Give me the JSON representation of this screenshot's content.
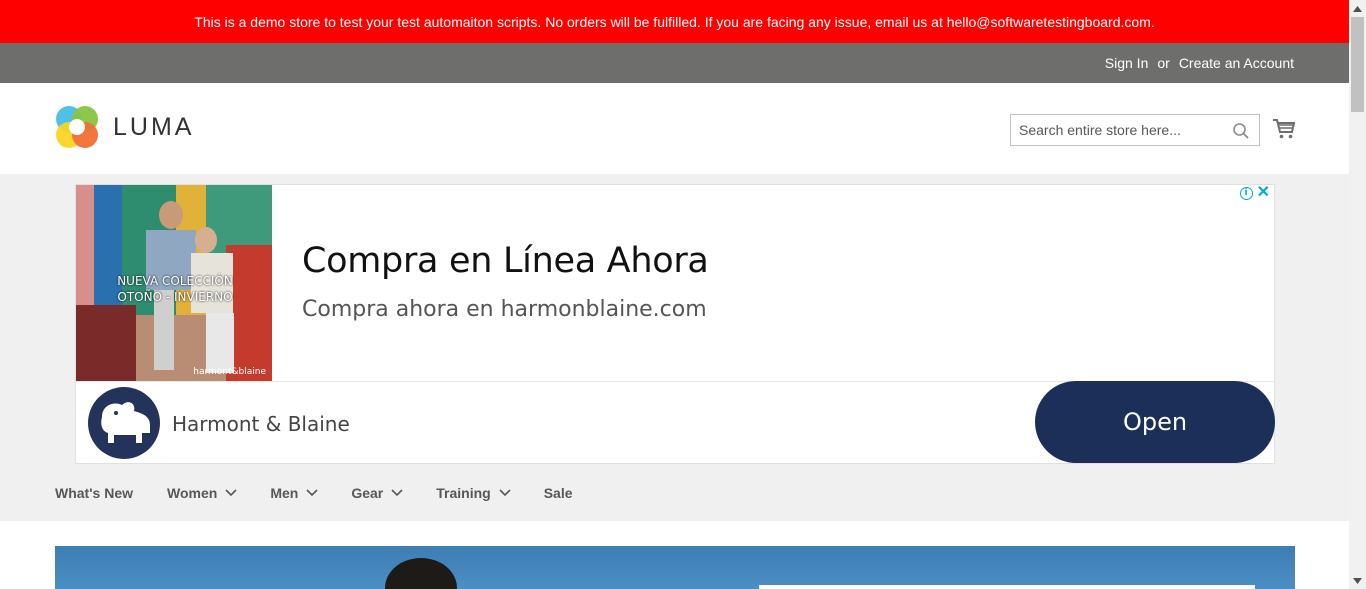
{
  "demo_notice": "This is a demo store to test your test automaiton scripts. No orders will be fulfilled. If you are facing any issue, email us at hello@softwaretestingboard.com.",
  "top_links": {
    "sign_in": "Sign In",
    "or": "or",
    "create_account": "Create an Account"
  },
  "logo": {
    "text": "LUMA"
  },
  "search": {
    "placeholder": "Search entire store here..."
  },
  "ad": {
    "image_text": "NUEVA COLECCIÓN OTOÑO - INVIERNO",
    "image_brand": "harmont&blaine",
    "title": "Compra en Línea Ahora",
    "subtitle": "Compra ahora en harmonblaine.com",
    "brand": "Harmont & Blaine",
    "cta": "Open",
    "info_icon": "i",
    "close_icon": "✕"
  },
  "nav": {
    "items": [
      {
        "label": "What's New",
        "has_dropdown": false
      },
      {
        "label": "Women",
        "has_dropdown": true
      },
      {
        "label": "Men",
        "has_dropdown": true
      },
      {
        "label": "Gear",
        "has_dropdown": true
      },
      {
        "label": "Training",
        "has_dropdown": true
      },
      {
        "label": "Sale",
        "has_dropdown": false
      }
    ]
  },
  "colors": {
    "demo_bar": "#ff0000",
    "top_bar": "#6e6e6c",
    "ad_button": "#1b2f59",
    "nav_bg": "#f0f0f0"
  }
}
